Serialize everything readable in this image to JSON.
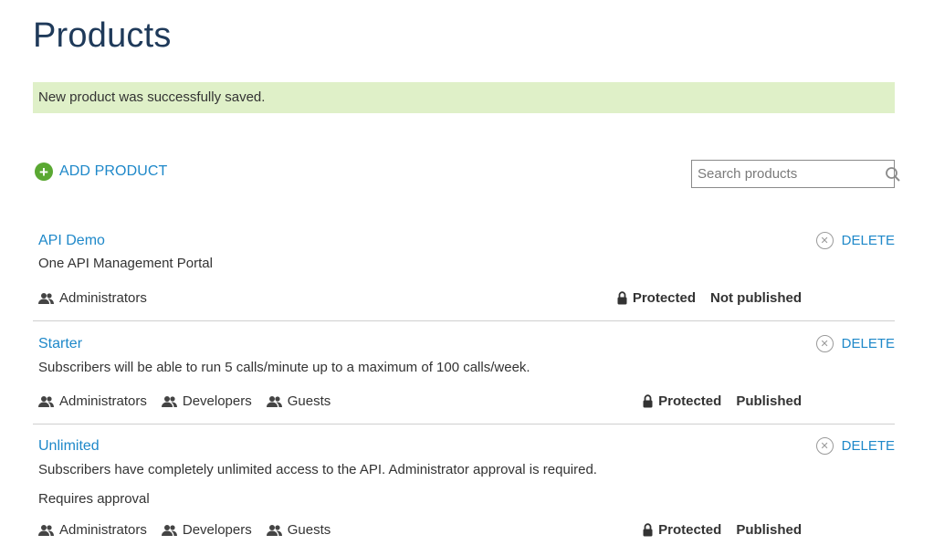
{
  "page": {
    "title": "Products"
  },
  "notice": {
    "text": "New product was successfully saved."
  },
  "toolbar": {
    "add_label": "ADD PRODUCT",
    "add_icon": "plus-circle-icon"
  },
  "search": {
    "placeholder": "Search products",
    "value": ""
  },
  "products": [
    {
      "name": "API Demo",
      "description": "One API Management Portal",
      "approval": "",
      "groups": [
        "Administrators"
      ],
      "protection": "Protected",
      "state": "Not published",
      "delete_label": "DELETE"
    },
    {
      "name": "Starter",
      "description": "Subscribers will be able to run 5 calls/minute up to a maximum of 100 calls/week.",
      "approval": "",
      "groups": [
        "Administrators",
        "Developers",
        "Guests"
      ],
      "protection": "Protected",
      "state": "Published",
      "delete_label": "DELETE"
    },
    {
      "name": "Unlimited",
      "description": "Subscribers have completely unlimited access to the API. Administrator approval is required.",
      "approval": "Requires approval",
      "groups": [
        "Administrators",
        "Developers",
        "Guests"
      ],
      "protection": "Protected",
      "state": "Published",
      "delete_label": "DELETE"
    }
  ],
  "colors": {
    "link": "#1e88c9",
    "title": "#1f3a5a",
    "success_bg": "#dff0c8",
    "add_icon": "#5aa832"
  }
}
